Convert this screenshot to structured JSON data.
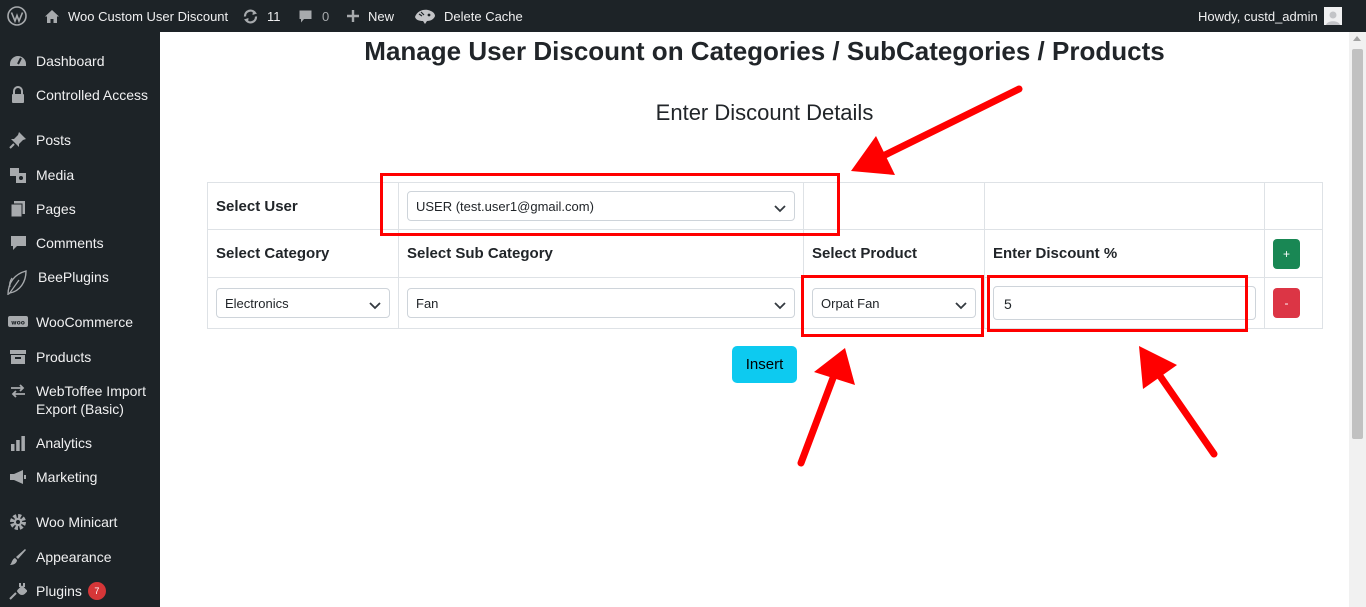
{
  "adminbar": {
    "site_name": "Woo Custom User Discount",
    "updates_count": "11",
    "comments_count": "0",
    "new_label": "New",
    "delete_cache_label": "Delete Cache",
    "howdy": "Howdy, custd_admin"
  },
  "sidebar": {
    "items": [
      {
        "label": "Dashboard",
        "icon": "dashboard-icon"
      },
      {
        "label": "Controlled Access",
        "icon": "lock-icon"
      },
      {
        "label": "Posts",
        "icon": "pin-icon"
      },
      {
        "label": "Media",
        "icon": "media-icon"
      },
      {
        "label": "Pages",
        "icon": "pages-icon"
      },
      {
        "label": "Comments",
        "icon": "comment-icon"
      },
      {
        "label": "BeePlugins",
        "icon": "leaf-icon"
      },
      {
        "label": "WooCommerce",
        "icon": "woo-icon"
      },
      {
        "label": "Products",
        "icon": "archive-icon"
      },
      {
        "label": "WebToffee Import Export (Basic)",
        "icon": "import-export-icon"
      },
      {
        "label": "Analytics",
        "icon": "bar-chart-icon"
      },
      {
        "label": "Marketing",
        "icon": "megaphone-icon"
      },
      {
        "label": "Woo Minicart",
        "icon": "gear-icon"
      },
      {
        "label": "Appearance",
        "icon": "brush-icon"
      },
      {
        "label": "Plugins",
        "icon": "plug-icon"
      }
    ],
    "plugins_badge": "7"
  },
  "main": {
    "title": "Manage User Discount on Categories / SubCategories / Products",
    "subtitle": "Enter Discount Details",
    "select_user_label": "Select User",
    "selected_user": "USER (test.user1@gmail.com)",
    "headers": {
      "category": "Select Category",
      "sub_category": "Select Sub Category",
      "product": "Select Product",
      "discount": "Enter Discount %"
    },
    "row": {
      "category": "Electronics",
      "sub_category": "Fan",
      "product": "Orpat Fan",
      "discount": "5"
    },
    "add_button": "+",
    "remove_button": "-",
    "insert_button": "Insert"
  },
  "colors": {
    "admin_bg": "#1d2327",
    "add_green": "#198754",
    "remove_red": "#dc3545",
    "insert_cyan": "#0dcaf0",
    "annotation_red": "#ff0000"
  }
}
